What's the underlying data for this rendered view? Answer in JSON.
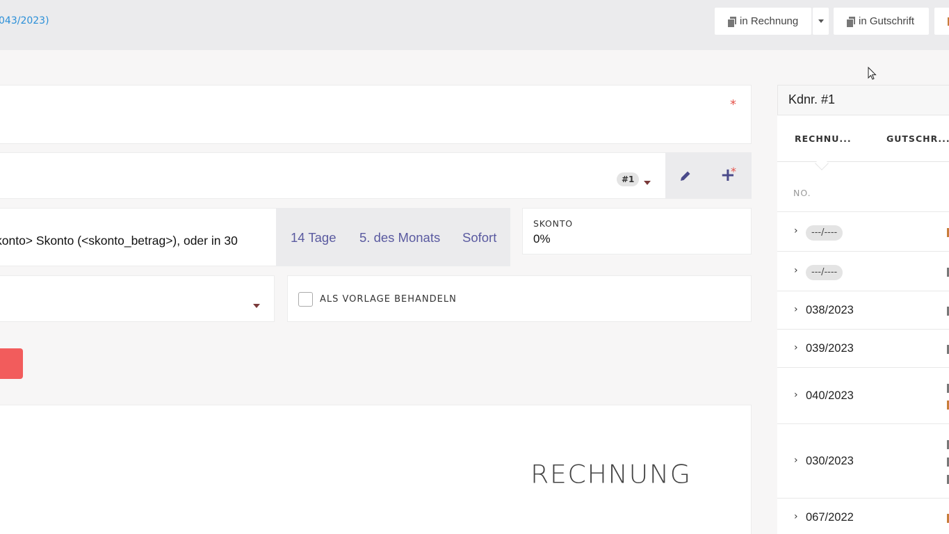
{
  "header": {
    "breadcrumb": "043/2023)",
    "buttons": {
      "to_invoice": "in Rechnung",
      "to_credit": "in Gutschrift"
    }
  },
  "form": {
    "required_marker": "*",
    "customer_badge": "#1",
    "payment_text": "konto> Skonto (<skonto_betrag>), oder in 30",
    "quick_terms": [
      "14 Tage",
      "5. des Monats",
      "Sofort"
    ],
    "skonto": {
      "label": "SKONTO",
      "value": "0%"
    },
    "template_checkbox": {
      "label": "ALS VORLAGE BEHANDELN",
      "checked": false
    }
  },
  "document": {
    "title": "RECHNUNG"
  },
  "sidebar": {
    "customer": "Kdnr. #1",
    "tabs": [
      "RECHNU...",
      "GUTSCHR..."
    ],
    "column_no": "NO.",
    "rows": [
      {
        "label": "---/----",
        "draft": true
      },
      {
        "label": "---/----",
        "draft": true
      },
      {
        "label": "038/2023",
        "draft": false
      },
      {
        "label": "039/2023",
        "draft": false
      },
      {
        "label": "040/2023",
        "draft": false
      },
      {
        "label": "030/2023",
        "draft": false
      },
      {
        "label": "067/2022",
        "draft": false
      }
    ]
  }
}
